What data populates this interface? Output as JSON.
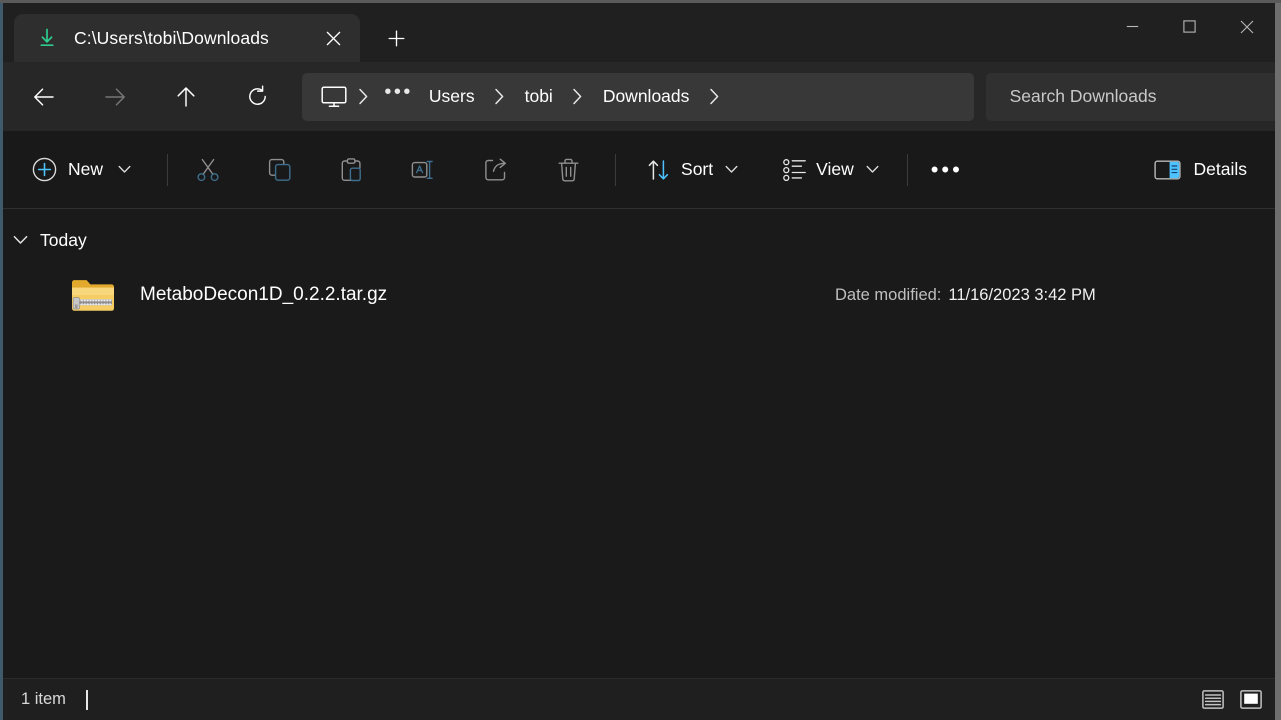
{
  "window": {
    "accent_left": "#3f5a6b",
    "accent_blue": "#4cc2ff",
    "download_green": "#2ecc8f"
  },
  "titlebar": {
    "tabs": [
      {
        "icon": "download-icon",
        "title": "C:\\Users\\tobi\\Downloads",
        "close_label": "Close tab"
      }
    ],
    "new_tab_label": "New tab",
    "controls": [
      {
        "name": "minimize",
        "label": "Minimize"
      },
      {
        "name": "maximize",
        "label": "Maximize"
      },
      {
        "name": "close",
        "label": "Close"
      }
    ]
  },
  "navbar": {
    "back_label": "Back",
    "forward_label": "Forward",
    "up_label": "Up to Users",
    "refresh_label": "Refresh",
    "address": {
      "root_icon": "this-pc-monitor-icon",
      "overflow": "•••",
      "crumbs": [
        "Users",
        "tobi",
        "Downloads"
      ]
    },
    "search": {
      "placeholder": "Search Downloads",
      "value": ""
    }
  },
  "commandbar": {
    "new_label": "New",
    "icons": [
      {
        "name": "cut-icon",
        "label": "Cut"
      },
      {
        "name": "copy-icon",
        "label": "Copy"
      },
      {
        "name": "paste-icon",
        "label": "Paste"
      },
      {
        "name": "rename-icon",
        "label": "Rename"
      },
      {
        "name": "share-icon",
        "label": "Share"
      },
      {
        "name": "delete-icon",
        "label": "Delete"
      }
    ],
    "sort_label": "Sort",
    "view_label": "View",
    "overflow_label": "•••",
    "details_label": "Details"
  },
  "filelist": {
    "group": {
      "label": "Today",
      "expanded": true
    },
    "columns": {
      "date_modified_label": "Date modified:"
    },
    "items": [
      {
        "icon": "zipped-folder-icon",
        "name": "MetaboDecon1D_0.2.2.tar.gz",
        "date_modified": "11/16/2023 3:42 PM"
      }
    ]
  },
  "statusbar": {
    "count": "1 item",
    "view_toggles": [
      {
        "name": "details-view-icon",
        "label": "Details view",
        "active": false
      },
      {
        "name": "large-icons-view-icon",
        "label": "Large icons view",
        "active": true
      }
    ]
  }
}
